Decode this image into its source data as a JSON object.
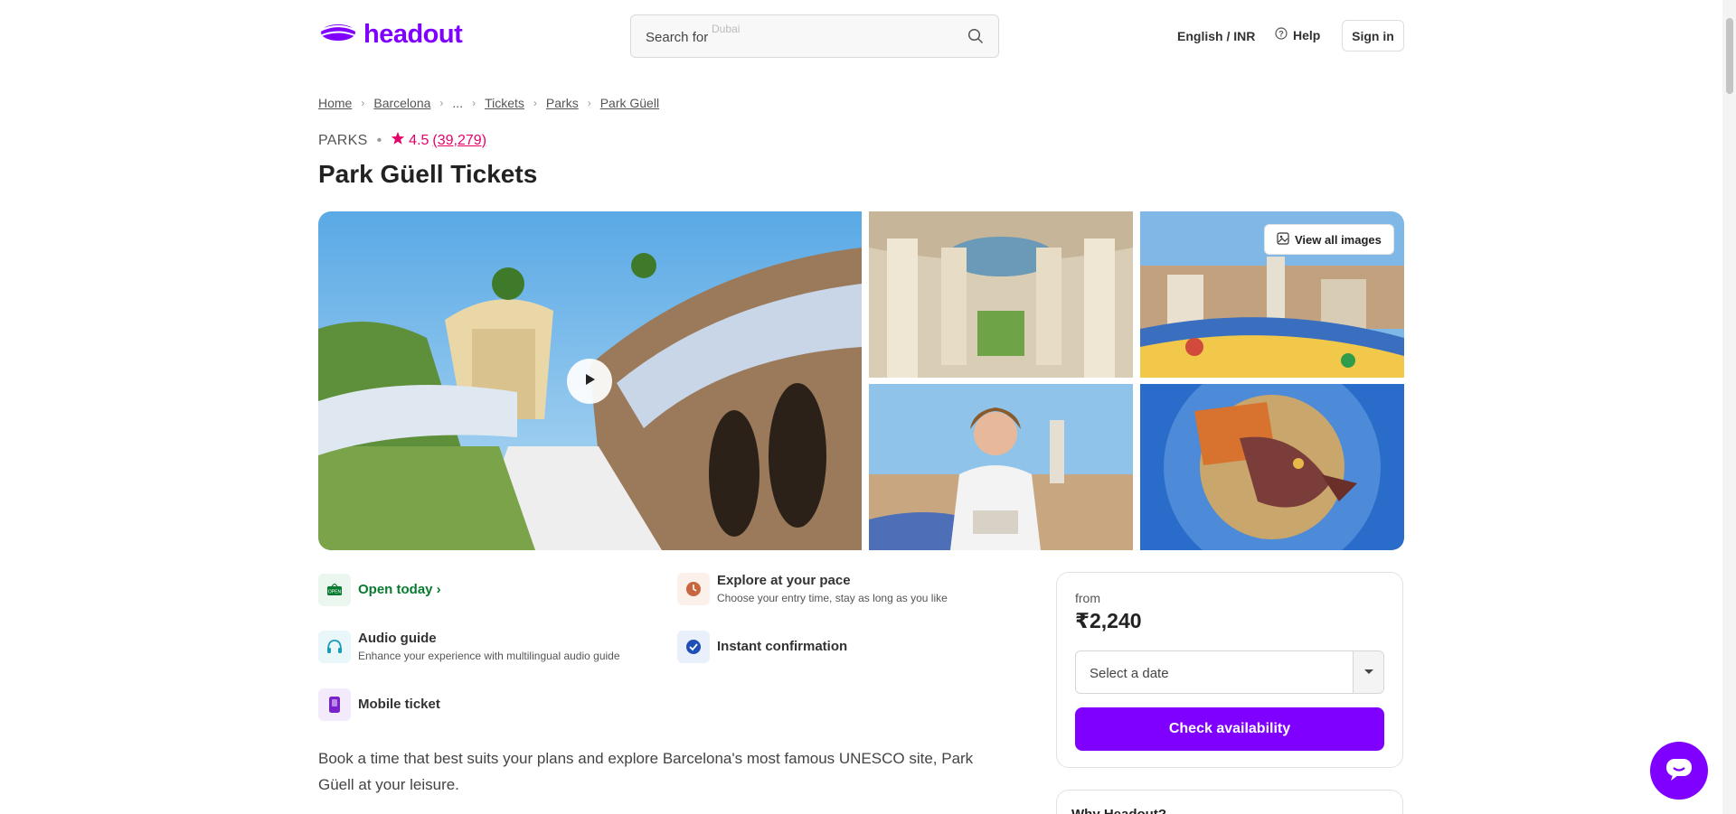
{
  "header": {
    "logo_text": "headout",
    "search_label": "Search for",
    "search_hint": "Dubai",
    "language_currency": "English / INR",
    "help_label": "Help",
    "signin_label": "Sign in"
  },
  "breadcrumb": [
    "Home",
    "Barcelona",
    "...",
    "Tickets",
    "Parks",
    "Park Güell"
  ],
  "meta": {
    "category": "PARKS",
    "rating": "4.5",
    "rating_count": "(39,279)"
  },
  "title": "Park Güell Tickets",
  "gallery": {
    "view_all_label": "View all images"
  },
  "features": [
    {
      "title": "Open today",
      "subtitle": "",
      "icon": "open-sign-icon",
      "color": "#087a2f"
    },
    {
      "title": "Explore at your pace",
      "subtitle": "Choose your entry time, stay as long as you like",
      "icon": "clock-icon",
      "color": "#c8663f"
    },
    {
      "title": "Audio guide",
      "subtitle": "Enhance your experience with multilingual audio guide",
      "icon": "headphones-icon",
      "color": "#1a9bb8"
    },
    {
      "title": "Instant confirmation",
      "subtitle": "",
      "icon": "check-circle-icon",
      "color": "#1f4fb6"
    },
    {
      "title": "Mobile ticket",
      "subtitle": "",
      "icon": "mobile-ticket-icon",
      "color": "#7a22c9"
    }
  ],
  "description": "Book a time that best suits your plans and explore Barcelona's most famous UNESCO site, Park Güell at your leisure.",
  "booking": {
    "from_label": "from",
    "price": "₹2,240",
    "date_placeholder": "Select a date",
    "cta_label": "Check availability"
  },
  "why_card": {
    "title": "Why Headout?"
  },
  "colors": {
    "brand": "#8000ff",
    "rating": "#e5006a",
    "open": "#087a2f"
  }
}
